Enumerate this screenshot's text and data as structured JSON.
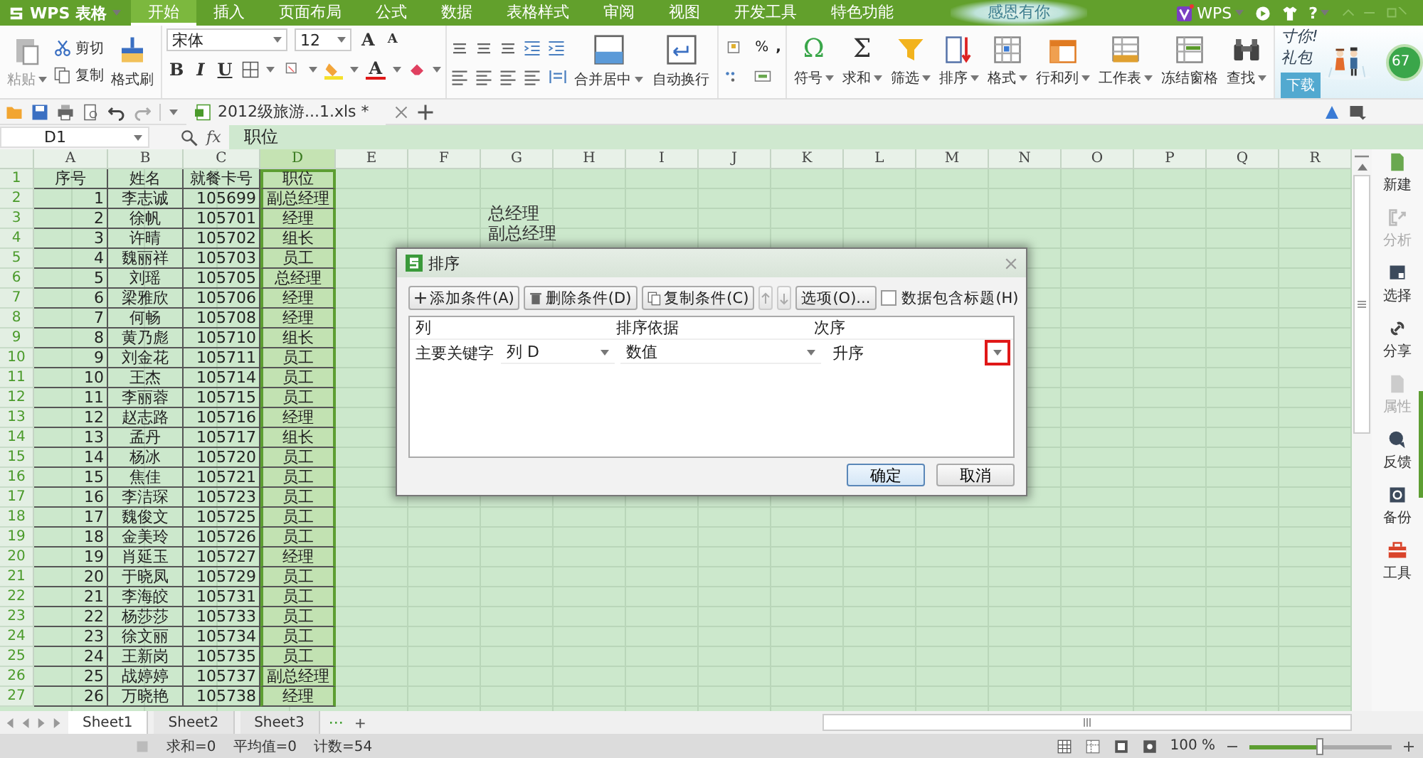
{
  "title_bar": {
    "logo": "WPS 表格",
    "banner": "感恩有你",
    "account": "WPS",
    "help": "?",
    "tabs": [
      {
        "label": "开始",
        "selected": true
      },
      {
        "label": "插入",
        "selected": false
      },
      {
        "label": "页面布局",
        "selected": false
      },
      {
        "label": "公式",
        "selected": false
      },
      {
        "label": "数据",
        "selected": false
      },
      {
        "label": "表格样式",
        "selected": false
      },
      {
        "label": "审阅",
        "selected": false
      },
      {
        "label": "视图",
        "selected": false
      },
      {
        "label": "开发工具",
        "selected": false
      },
      {
        "label": "特色功能",
        "selected": false
      }
    ]
  },
  "ribbon": {
    "paste": "粘贴",
    "cut": "剪切",
    "copy": "复制",
    "format_painter": "格式刷",
    "font_name": "宋体",
    "font_size": "12",
    "grow": "A",
    "shrink": "A",
    "bold": "B",
    "italic": "I",
    "underline": "U",
    "font_color": "A",
    "merge": "合并居中",
    "wrap": "自动换行",
    "percent": "%",
    "comma": ",",
    "tools": [
      {
        "label": "符号",
        "glyph": "Ω"
      },
      {
        "label": "求和",
        "glyph": "Σ"
      },
      {
        "label": "筛选"
      },
      {
        "label": "排序"
      },
      {
        "label": "格式"
      },
      {
        "label": "行和列"
      },
      {
        "label": "工作表"
      },
      {
        "label": "冻结窗格"
      },
      {
        "label": "查找"
      }
    ],
    "promo": {
      "slogan": [
        "寸你!",
        "礼包"
      ],
      "download": "下载",
      "badge": "67"
    }
  },
  "doc_tab": {
    "title": "2012级旅游...1.xls *"
  },
  "formula_bar": {
    "cell": "D1",
    "fx": "fx",
    "value": "职位"
  },
  "sheet": {
    "columns": [
      "A",
      "B",
      "C",
      "D",
      "E",
      "F",
      "G",
      "H",
      "I",
      "J",
      "K",
      "L",
      "M",
      "N",
      "O",
      "P",
      "Q",
      "R"
    ],
    "rows": [
      {
        "n": "1",
        "cells": [
          "序号",
          "姓名",
          "就餐卡号",
          "职位"
        ]
      },
      {
        "n": "2",
        "cells": [
          "1",
          "李志诚",
          "105699",
          "副总经理"
        ]
      },
      {
        "n": "3",
        "cells": [
          "2",
          "徐帆",
          "105701",
          "经理"
        ]
      },
      {
        "n": "4",
        "cells": [
          "3",
          "许晴",
          "105702",
          "组长"
        ]
      },
      {
        "n": "5",
        "cells": [
          "4",
          "魏丽祥",
          "105703",
          "员工"
        ]
      },
      {
        "n": "6",
        "cells": [
          "5",
          "刘瑶",
          "105705",
          "总经理"
        ]
      },
      {
        "n": "7",
        "cells": [
          "6",
          "梁雅欣",
          "105706",
          "经理"
        ]
      },
      {
        "n": "8",
        "cells": [
          "7",
          "何畅",
          "105708",
          "经理"
        ]
      },
      {
        "n": "9",
        "cells": [
          "8",
          "黄乃彪",
          "105710",
          "组长"
        ]
      },
      {
        "n": "10",
        "cells": [
          "9",
          "刘金花",
          "105711",
          "员工"
        ]
      },
      {
        "n": "11",
        "cells": [
          "10",
          "王杰",
          "105714",
          "员工"
        ]
      },
      {
        "n": "12",
        "cells": [
          "11",
          "李丽蓉",
          "105715",
          "员工"
        ]
      },
      {
        "n": "13",
        "cells": [
          "12",
          "赵志路",
          "105716",
          "经理"
        ]
      },
      {
        "n": "14",
        "cells": [
          "13",
          "孟丹",
          "105717",
          "组长"
        ]
      },
      {
        "n": "15",
        "cells": [
          "14",
          "杨冰",
          "105720",
          "员工"
        ]
      },
      {
        "n": "16",
        "cells": [
          "15",
          "焦佳",
          "105721",
          "员工"
        ]
      },
      {
        "n": "17",
        "cells": [
          "16",
          "李洁琛",
          "105723",
          "员工"
        ]
      },
      {
        "n": "18",
        "cells": [
          "17",
          "魏俊文",
          "105725",
          "员工"
        ]
      },
      {
        "n": "19",
        "cells": [
          "18",
          "金美玲",
          "105726",
          "员工"
        ]
      },
      {
        "n": "20",
        "cells": [
          "19",
          "肖延玉",
          "105727",
          "经理"
        ]
      },
      {
        "n": "21",
        "cells": [
          "20",
          "于晓凤",
          "105729",
          "员工"
        ]
      },
      {
        "n": "22",
        "cells": [
          "21",
          "李海皎",
          "105731",
          "员工"
        ]
      },
      {
        "n": "23",
        "cells": [
          "22",
          "杨莎莎",
          "105733",
          "员工"
        ]
      },
      {
        "n": "24",
        "cells": [
          "23",
          "徐文丽",
          "105734",
          "员工"
        ]
      },
      {
        "n": "25",
        "cells": [
          "24",
          "王新岗",
          "105735",
          "员工"
        ]
      },
      {
        "n": "26",
        "cells": [
          "25",
          "战婷婷",
          "105737",
          "副总经理"
        ]
      },
      {
        "n": "27",
        "cells": [
          "26",
          "万晓艳",
          "105738",
          "经理"
        ]
      }
    ]
  },
  "drag_preview": [
    "总经理",
    "副总经理"
  ],
  "dialog": {
    "title": "排序",
    "add": "添加条件(A)",
    "delete": "删除条件(D)",
    "copy": "复制条件(C)",
    "options": "选项(O)...",
    "has_header": {
      "label": "数据包含标题(H)",
      "checked": false
    },
    "columns": [
      "列",
      "排序依据",
      "次序"
    ],
    "condition": {
      "label": "主要关键字",
      "column": "列 D",
      "basis": "数值",
      "order": "升序"
    },
    "ok": "确定",
    "cancel": "取消"
  },
  "sheet_tabs": [
    {
      "label": "Sheet1",
      "selected": true
    },
    {
      "label": "Sheet2",
      "selected": false
    },
    {
      "label": "Sheet3",
      "selected": false
    }
  ],
  "sheet_more": "···",
  "sheet_add": "+",
  "status": [
    "求和=0",
    "平均值=0",
    "计数=54"
  ],
  "zoom": {
    "label": "100 %",
    "level": 0.5
  },
  "sidebar": [
    {
      "label": "新建",
      "disabled": false
    },
    {
      "label": "分析",
      "disabled": true
    },
    {
      "label": "选择",
      "disabled": false
    },
    {
      "label": "分享",
      "disabled": false
    },
    {
      "label": "属性",
      "disabled": true
    },
    {
      "label": "反馈",
      "disabled": false
    },
    {
      "label": "备份",
      "disabled": false
    },
    {
      "label": "工具",
      "disabled": false
    }
  ]
}
